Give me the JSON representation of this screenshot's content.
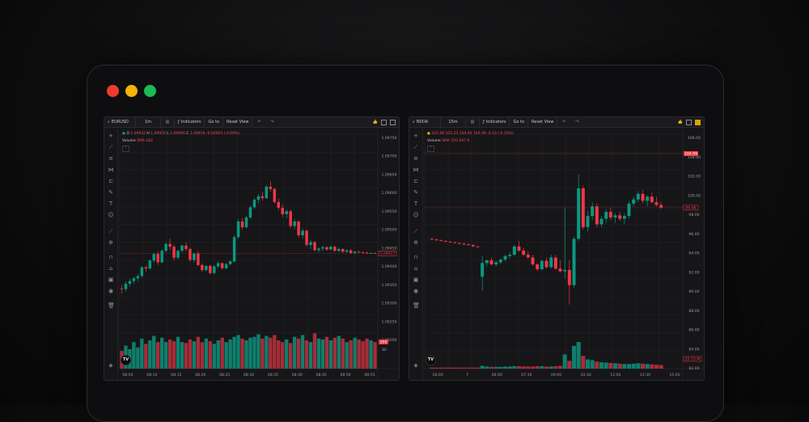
{
  "window": {
    "traffic_lights": {
      "close": "#ee3b2e",
      "minimize": "#f5b400",
      "zoom": "#1db954"
    }
  },
  "colors": {
    "up": "#089981",
    "down": "#f23645",
    "up_vol": "#0e7f6d",
    "down_vol": "#a72d39",
    "grid": "#242428",
    "text": "#9d9da1"
  },
  "left": {
    "symbol": "EURUSD",
    "interval": "1m",
    "indicators_label": "Indicators",
    "goto_label": "Go to",
    "reset_label": "Reset View",
    "ohlc": {
      "o_label": "O",
      "o": "1.09932",
      "h_label": "H",
      "h": "1.09950",
      "l_label": "L",
      "l": "1.09906",
      "c_label": "C",
      "c": "1.09919",
      "chg": "-0.00003 (-0.00%)"
    },
    "volume_label": "Volume",
    "volume_sma": "SMA 282",
    "price_labels": [
      "1.09750",
      "1.09700",
      "1.09650",
      "1.09600",
      "1.09550",
      "1.09500",
      "1.09450",
      "1.09400",
      "1.09350",
      "1.09300",
      "1.09250",
      "1.09200"
    ],
    "last_price": "1.09917",
    "volume_badge": "209",
    "volume_axis_label": "80",
    "time_labels": [
      "08:05",
      "08:10",
      "08:15",
      "08:20",
      "08:25",
      "08:30",
      "08:35",
      "08:40",
      "08:45",
      "08:50",
      "08:55"
    ]
  },
  "right": {
    "symbol": "NVDA",
    "interval": "15m",
    "indicators_label": "Indicators",
    "goto_label": "Go to",
    "reset_label": "Reset View",
    "ohlc": {
      "o": "105.09",
      "h": "105.23",
      "l": "104.94",
      "c": "104.99",
      "chg": "-0.10 (-0.10%)"
    },
    "volume_label": "Volume",
    "volume_sma": "SMA 550.047 K",
    "price_labels": [
      "106.00",
      "104.00",
      "102.00",
      "100.00",
      "98.00",
      "96.00",
      "94.00",
      "92.00",
      "90.00",
      "88.00",
      "86.00",
      "84.00",
      "82.00"
    ],
    "top_badge": "104.99",
    "last_price": "96.68",
    "volume_badge": "25.15 M",
    "time_labels": [
      "18:00",
      "7",
      "06:00",
      "07:30",
      "09:00",
      "10:30",
      "12:00",
      "13:30",
      "15:00"
    ]
  },
  "chart_data": [
    {
      "type": "candlestick",
      "title": "EURUSD",
      "interval": "1m",
      "ylim": [
        1.0917,
        1.0977
      ],
      "candles": [
        [
          1.09238,
          1.09252,
          1.09215,
          1.09235
        ],
        [
          1.09235,
          1.09268,
          1.09225,
          1.09258
        ],
        [
          1.09258,
          1.0928,
          1.09245,
          1.0927
        ],
        [
          1.0927,
          1.09288,
          1.09258,
          1.09282
        ],
        [
          1.09282,
          1.093,
          1.0927,
          1.09292
        ],
        [
          1.09292,
          1.09335,
          1.09285,
          1.0933
        ],
        [
          1.0933,
          1.09338,
          1.0931,
          1.09325
        ],
        [
          1.09325,
          1.09365,
          1.0932,
          1.0936
        ],
        [
          1.0936,
          1.09395,
          1.0935,
          1.09388
        ],
        [
          1.09388,
          1.094,
          1.0934,
          1.09352
        ],
        [
          1.09352,
          1.0941,
          1.09348,
          1.09402
        ],
        [
          1.09402,
          1.0944,
          1.09395,
          1.09432
        ],
        [
          1.09432,
          1.09455,
          1.09405,
          1.0942
        ],
        [
          1.0942,
          1.09428,
          1.0936,
          1.09372
        ],
        [
          1.09372,
          1.09408,
          1.09365,
          1.09402
        ],
        [
          1.09402,
          1.0943,
          1.09395,
          1.09425
        ],
        [
          1.09425,
          1.0944,
          1.094,
          1.0941
        ],
        [
          1.0941,
          1.09416,
          1.09355,
          1.09362
        ],
        [
          1.09362,
          1.09395,
          1.0935,
          1.0939
        ],
        [
          1.0939,
          1.09402,
          1.09335,
          1.0934
        ],
        [
          1.0934,
          1.09348,
          1.0931,
          1.09318
        ],
        [
          1.09318,
          1.0934,
          1.09312,
          1.09336
        ],
        [
          1.09336,
          1.09342,
          1.09298,
          1.09305
        ],
        [
          1.09305,
          1.0934,
          1.093,
          1.09334
        ],
        [
          1.09334,
          1.09356,
          1.09326,
          1.09348
        ],
        [
          1.09348,
          1.09352,
          1.0932,
          1.09326
        ],
        [
          1.09326,
          1.0935,
          1.0932,
          1.09344
        ],
        [
          1.09344,
          1.09362,
          1.09338,
          1.09356
        ],
        [
          1.09356,
          1.0947,
          1.0935,
          1.09462
        ],
        [
          1.09462,
          1.0954,
          1.09455,
          1.0953
        ],
        [
          1.0953,
          1.09545,
          1.09495,
          1.09505
        ],
        [
          1.09505,
          1.09555,
          1.095,
          1.09548
        ],
        [
          1.09548,
          1.096,
          1.0954,
          1.09592
        ],
        [
          1.09592,
          1.09632,
          1.09585,
          1.09625
        ],
        [
          1.09625,
          1.0965,
          1.0961,
          1.0964
        ],
        [
          1.0964,
          1.0966,
          1.0962,
          1.09632
        ],
        [
          1.09632,
          1.0969,
          1.09628,
          1.09682
        ],
        [
          1.09682,
          1.09705,
          1.0966,
          1.09672
        ],
        [
          1.09672,
          1.09678,
          1.09608,
          1.09615
        ],
        [
          1.09615,
          1.0963,
          1.0958,
          1.0959
        ],
        [
          1.0959,
          1.09605,
          1.0955,
          1.09562
        ],
        [
          1.09562,
          1.09585,
          1.09545,
          1.09575
        ],
        [
          1.09575,
          1.09582,
          1.095,
          1.0951
        ],
        [
          1.0951,
          1.0954,
          1.09495,
          1.0953
        ],
        [
          1.0953,
          1.09535,
          1.0946,
          1.0947
        ],
        [
          1.0947,
          1.095,
          1.09455,
          1.0949
        ],
        [
          1.0949,
          1.09495,
          1.0942,
          1.09428
        ],
        [
          1.09428,
          1.0945,
          1.0941,
          1.0944
        ],
        [
          1.0944,
          1.09446,
          1.09398,
          1.09405
        ],
        [
          1.09405,
          1.09418,
          1.09395,
          1.09412
        ],
        [
          1.09412,
          1.09425,
          1.094,
          1.09418
        ],
        [
          1.09418,
          1.09422,
          1.09402,
          1.09408
        ],
        [
          1.09408,
          1.09428,
          1.09404,
          1.0942
        ],
        [
          1.0942,
          1.09424,
          1.09398,
          1.09402
        ],
        [
          1.09402,
          1.09416,
          1.09396,
          1.0941
        ],
        [
          1.0941,
          1.09414,
          1.09395,
          1.09398
        ],
        [
          1.09398,
          1.0941,
          1.09394,
          1.09404
        ],
        [
          1.09404,
          1.0941,
          1.0939,
          1.09392
        ],
        [
          1.09392,
          1.09402,
          1.09388,
          1.09398
        ],
        [
          1.09398,
          1.09402,
          1.09392,
          1.09396
        ],
        [
          1.09396,
          1.094,
          1.0939,
          1.09394
        ],
        [
          1.09394,
          1.09398,
          1.09388,
          1.09392
        ],
        [
          1.09392,
          1.09396,
          1.09388,
          1.09392
        ],
        [
          1.09392,
          1.09395,
          1.09389,
          1.09391
        ]
      ],
      "volume": [
        100,
        130,
        110,
        150,
        120,
        170,
        140,
        160,
        185,
        150,
        175,
        150,
        165,
        155,
        180,
        150,
        145,
        165,
        155,
        180,
        150,
        170,
        155,
        140,
        160,
        175,
        150,
        165,
        180,
        190,
        170,
        160,
        175,
        180,
        195,
        170,
        185,
        175,
        190,
        160,
        150,
        165,
        145,
        180,
        170,
        190,
        160,
        150,
        200,
        170,
        165,
        180,
        160,
        175,
        185,
        170,
        150,
        160,
        175,
        165,
        155,
        170,
        160,
        150
      ],
      "volume_ylim": [
        0,
        320
      ]
    },
    {
      "type": "candlestick",
      "title": "NVDA",
      "interval": "15m",
      "ylim": [
        81.5,
        107.0
      ],
      "candles": [
        [
          93.5,
          93.6,
          93.3,
          93.4
        ],
        [
          93.4,
          93.5,
          93.2,
          93.3
        ],
        [
          93.3,
          93.4,
          93.1,
          93.2
        ],
        [
          93.2,
          93.3,
          93.0,
          93.1
        ],
        [
          93.1,
          93.2,
          92.9,
          93.0
        ],
        [
          93.0,
          93.1,
          92.8,
          92.9
        ],
        [
          92.9,
          93.0,
          92.7,
          92.8
        ],
        [
          92.8,
          92.9,
          92.6,
          92.7
        ],
        [
          92.7,
          92.8,
          92.5,
          92.6
        ],
        [
          92.6,
          92.7,
          92.3,
          92.4
        ],
        [
          92.4,
          92.5,
          92.2,
          92.3
        ],
        [
          88.0,
          91.0,
          86.0,
          90.0
        ],
        [
          90.0,
          90.5,
          89.5,
          90.4
        ],
        [
          90.4,
          90.8,
          89.6,
          89.8
        ],
        [
          89.8,
          90.3,
          89.5,
          90.1
        ],
        [
          90.1,
          90.6,
          89.8,
          90.5
        ],
        [
          90.5,
          91.2,
          90.2,
          91.0
        ],
        [
          91.0,
          91.6,
          90.6,
          91.2
        ],
        [
          91.2,
          92.6,
          91.0,
          92.4
        ],
        [
          92.4,
          93.2,
          91.6,
          91.8
        ],
        [
          91.8,
          92.2,
          91.0,
          91.2
        ],
        [
          91.2,
          91.7,
          90.6,
          90.8
        ],
        [
          90.8,
          91.2,
          89.6,
          89.8
        ],
        [
          89.8,
          90.0,
          88.8,
          89.1
        ],
        [
          89.1,
          90.5,
          88.9,
          90.3
        ],
        [
          90.3,
          90.8,
          89.2,
          89.4
        ],
        [
          89.4,
          91.2,
          89.2,
          90.8
        ],
        [
          90.8,
          91.2,
          89.0,
          89.2
        ],
        [
          89.2,
          90.4,
          88.6,
          88.8
        ],
        [
          88.8,
          98.0,
          87.8,
          89.0
        ],
        [
          89.0,
          90.4,
          84.0,
          86.8
        ],
        [
          86.8,
          93.8,
          86.4,
          93.5
        ],
        [
          93.5,
          102.8,
          93.2,
          100.8
        ],
        [
          100.8,
          101.2,
          94.8,
          95.2
        ],
        [
          95.2,
          97.6,
          94.6,
          96.8
        ],
        [
          96.8,
          98.8,
          96.2,
          98.2
        ],
        [
          98.2,
          98.6,
          95.2,
          95.6
        ],
        [
          95.6,
          96.8,
          95.2,
          96.4
        ],
        [
          96.4,
          97.8,
          95.8,
          97.4
        ],
        [
          97.4,
          98.0,
          96.2,
          96.6
        ],
        [
          96.6,
          97.2,
          95.8,
          96.9
        ],
        [
          96.9,
          97.4,
          96.1,
          96.4
        ],
        [
          96.4,
          97.2,
          95.6,
          96.8
        ],
        [
          96.8,
          99.0,
          96.4,
          98.6
        ],
        [
          98.6,
          99.6,
          98.2,
          99.2
        ],
        [
          99.2,
          100.4,
          98.8,
          100.0
        ],
        [
          100.0,
          100.6,
          98.6,
          99.0
        ],
        [
          99.0,
          99.8,
          98.2,
          99.6
        ],
        [
          99.6,
          100.2,
          98.6,
          98.8
        ],
        [
          98.8,
          99.6,
          98.2,
          98.4
        ],
        [
          98.4,
          98.9,
          97.8,
          98.0
        ]
      ],
      "volume": [
        0.3,
        0.3,
        0.3,
        0.3,
        0.3,
        0.3,
        0.3,
        0.3,
        0.3,
        0.3,
        0.3,
        0.8,
        0.6,
        0.5,
        0.5,
        0.5,
        0.6,
        0.6,
        0.7,
        0.7,
        0.6,
        0.6,
        0.6,
        0.7,
        0.7,
        0.6,
        0.6,
        0.7,
        0.8,
        4.0,
        2.2,
        6.4,
        7.5,
        3.6,
        2.6,
        2.4,
        2.0,
        1.8,
        1.7,
        1.6,
        1.5,
        1.4,
        1.3,
        1.3,
        1.4,
        1.5,
        1.4,
        1.3,
        1.2,
        1.1,
        1.0
      ],
      "volume_ylim": [
        0,
        25
      ]
    }
  ]
}
